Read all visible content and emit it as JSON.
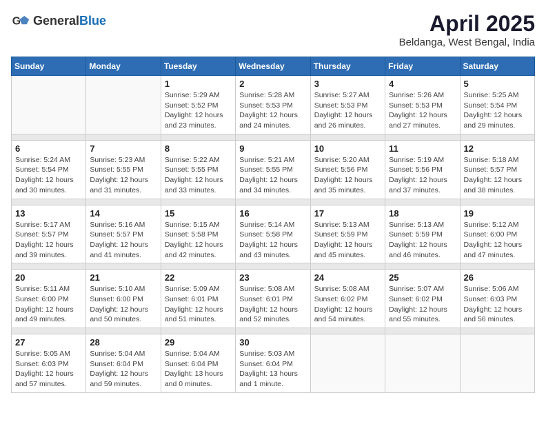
{
  "header": {
    "logo": {
      "general": "General",
      "blue": "Blue"
    },
    "title": "April 2025",
    "subtitle": "Beldanga, West Bengal, India"
  },
  "calendar": {
    "days_of_week": [
      "Sunday",
      "Monday",
      "Tuesday",
      "Wednesday",
      "Thursday",
      "Friday",
      "Saturday"
    ],
    "weeks": [
      [
        {
          "day": "",
          "detail": ""
        },
        {
          "day": "",
          "detail": ""
        },
        {
          "day": "1",
          "detail": "Sunrise: 5:29 AM\nSunset: 5:52 PM\nDaylight: 12 hours and 23 minutes."
        },
        {
          "day": "2",
          "detail": "Sunrise: 5:28 AM\nSunset: 5:53 PM\nDaylight: 12 hours and 24 minutes."
        },
        {
          "day": "3",
          "detail": "Sunrise: 5:27 AM\nSunset: 5:53 PM\nDaylight: 12 hours and 26 minutes."
        },
        {
          "day": "4",
          "detail": "Sunrise: 5:26 AM\nSunset: 5:53 PM\nDaylight: 12 hours and 27 minutes."
        },
        {
          "day": "5",
          "detail": "Sunrise: 5:25 AM\nSunset: 5:54 PM\nDaylight: 12 hours and 29 minutes."
        }
      ],
      [
        {
          "day": "6",
          "detail": "Sunrise: 5:24 AM\nSunset: 5:54 PM\nDaylight: 12 hours and 30 minutes."
        },
        {
          "day": "7",
          "detail": "Sunrise: 5:23 AM\nSunset: 5:55 PM\nDaylight: 12 hours and 31 minutes."
        },
        {
          "day": "8",
          "detail": "Sunrise: 5:22 AM\nSunset: 5:55 PM\nDaylight: 12 hours and 33 minutes."
        },
        {
          "day": "9",
          "detail": "Sunrise: 5:21 AM\nSunset: 5:55 PM\nDaylight: 12 hours and 34 minutes."
        },
        {
          "day": "10",
          "detail": "Sunrise: 5:20 AM\nSunset: 5:56 PM\nDaylight: 12 hours and 35 minutes."
        },
        {
          "day": "11",
          "detail": "Sunrise: 5:19 AM\nSunset: 5:56 PM\nDaylight: 12 hours and 37 minutes."
        },
        {
          "day": "12",
          "detail": "Sunrise: 5:18 AM\nSunset: 5:57 PM\nDaylight: 12 hours and 38 minutes."
        }
      ],
      [
        {
          "day": "13",
          "detail": "Sunrise: 5:17 AM\nSunset: 5:57 PM\nDaylight: 12 hours and 39 minutes."
        },
        {
          "day": "14",
          "detail": "Sunrise: 5:16 AM\nSunset: 5:57 PM\nDaylight: 12 hours and 41 minutes."
        },
        {
          "day": "15",
          "detail": "Sunrise: 5:15 AM\nSunset: 5:58 PM\nDaylight: 12 hours and 42 minutes."
        },
        {
          "day": "16",
          "detail": "Sunrise: 5:14 AM\nSunset: 5:58 PM\nDaylight: 12 hours and 43 minutes."
        },
        {
          "day": "17",
          "detail": "Sunrise: 5:13 AM\nSunset: 5:59 PM\nDaylight: 12 hours and 45 minutes."
        },
        {
          "day": "18",
          "detail": "Sunrise: 5:13 AM\nSunset: 5:59 PM\nDaylight: 12 hours and 46 minutes."
        },
        {
          "day": "19",
          "detail": "Sunrise: 5:12 AM\nSunset: 6:00 PM\nDaylight: 12 hours and 47 minutes."
        }
      ],
      [
        {
          "day": "20",
          "detail": "Sunrise: 5:11 AM\nSunset: 6:00 PM\nDaylight: 12 hours and 49 minutes."
        },
        {
          "day": "21",
          "detail": "Sunrise: 5:10 AM\nSunset: 6:00 PM\nDaylight: 12 hours and 50 minutes."
        },
        {
          "day": "22",
          "detail": "Sunrise: 5:09 AM\nSunset: 6:01 PM\nDaylight: 12 hours and 51 minutes."
        },
        {
          "day": "23",
          "detail": "Sunrise: 5:08 AM\nSunset: 6:01 PM\nDaylight: 12 hours and 52 minutes."
        },
        {
          "day": "24",
          "detail": "Sunrise: 5:08 AM\nSunset: 6:02 PM\nDaylight: 12 hours and 54 minutes."
        },
        {
          "day": "25",
          "detail": "Sunrise: 5:07 AM\nSunset: 6:02 PM\nDaylight: 12 hours and 55 minutes."
        },
        {
          "day": "26",
          "detail": "Sunrise: 5:06 AM\nSunset: 6:03 PM\nDaylight: 12 hours and 56 minutes."
        }
      ],
      [
        {
          "day": "27",
          "detail": "Sunrise: 5:05 AM\nSunset: 6:03 PM\nDaylight: 12 hours and 57 minutes."
        },
        {
          "day": "28",
          "detail": "Sunrise: 5:04 AM\nSunset: 6:04 PM\nDaylight: 12 hours and 59 minutes."
        },
        {
          "day": "29",
          "detail": "Sunrise: 5:04 AM\nSunset: 6:04 PM\nDaylight: 13 hours and 0 minutes."
        },
        {
          "day": "30",
          "detail": "Sunrise: 5:03 AM\nSunset: 6:04 PM\nDaylight: 13 hours and 1 minute."
        },
        {
          "day": "",
          "detail": ""
        },
        {
          "day": "",
          "detail": ""
        },
        {
          "day": "",
          "detail": ""
        }
      ]
    ]
  }
}
